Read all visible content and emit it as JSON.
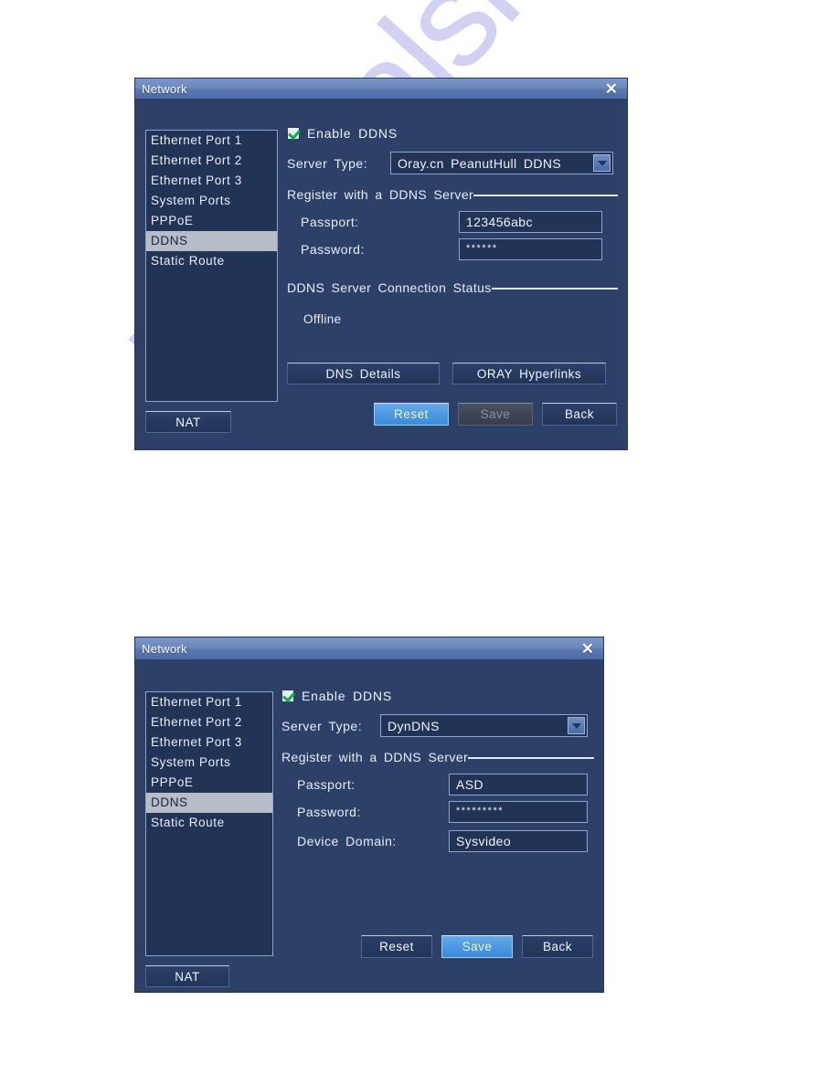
{
  "watermark": {
    "text": "manualshive.com"
  },
  "dialogs": [
    {
      "title": "Network",
      "close_icon": "close-icon",
      "nav": {
        "items": [
          {
            "label": "Ethernet Port 1",
            "selected": false
          },
          {
            "label": "Ethernet Port 2",
            "selected": false
          },
          {
            "label": "Ethernet Port 3",
            "selected": false
          },
          {
            "label": "System Ports",
            "selected": false
          },
          {
            "label": "PPPoE",
            "selected": false
          },
          {
            "label": "DDNS",
            "selected": true
          },
          {
            "label": "Static Route",
            "selected": false
          }
        ]
      },
      "enable_ddns": {
        "label": "Enable DDNS",
        "checked": true
      },
      "server_type": {
        "label": "Server Type:",
        "value": "Oray.cn PeanutHull DDNS"
      },
      "register_group": {
        "title": "Register with a DDNS Server"
      },
      "passport": {
        "label": "Passport:",
        "value": "123456abc"
      },
      "password": {
        "label": "Password:",
        "value": "******"
      },
      "status_group": {
        "title": "DDNS Server Connection Status"
      },
      "status": {
        "value": "Offline"
      },
      "dns_details_button": "DNS Details",
      "oray_hyperlinks_button": "ORAY Hyperlinks",
      "nat_button": "NAT",
      "reset_button": "Reset",
      "save_button": "Save",
      "back_button": "Back",
      "button_states": {
        "reset": "active",
        "save": "disabled",
        "back": "normal"
      }
    },
    {
      "title": "Network",
      "close_icon": "close-icon",
      "nav": {
        "items": [
          {
            "label": "Ethernet Port 1",
            "selected": false
          },
          {
            "label": "Ethernet Port 2",
            "selected": false
          },
          {
            "label": "Ethernet Port 3",
            "selected": false
          },
          {
            "label": "System Ports",
            "selected": false
          },
          {
            "label": "PPPoE",
            "selected": false
          },
          {
            "label": "DDNS",
            "selected": true
          },
          {
            "label": "Static Route",
            "selected": false
          }
        ]
      },
      "enable_ddns": {
        "label": "Enable DDNS",
        "checked": true
      },
      "server_type": {
        "label": "Server Type:",
        "value": "DynDNS"
      },
      "register_group": {
        "title": "Register with a DDNS Server"
      },
      "passport": {
        "label": "Passport:",
        "value": "ASD"
      },
      "password": {
        "label": "Password:",
        "value": "*********"
      },
      "device_domain": {
        "label": "Device Domain:",
        "value": "Sysvideo"
      },
      "nat_button": "NAT",
      "reset_button": "Reset",
      "save_button": "Save",
      "back_button": "Back",
      "button_states": {
        "reset": "normal",
        "save": "active",
        "back": "normal"
      }
    }
  ],
  "colors": {
    "dialog_bg": "#2c4068",
    "titlebar_from": "#7b95c6",
    "titlebar_to": "#4d6ba6",
    "field_bg": "#223456",
    "field_border": "#8ea4c8",
    "nav_selected_bg": "#b6bdc9",
    "accent_blue": "#4f9ae4",
    "accent_text": "#eaf7b9",
    "check_green": "#0fae3f",
    "watermark": "#c9c9ef"
  }
}
